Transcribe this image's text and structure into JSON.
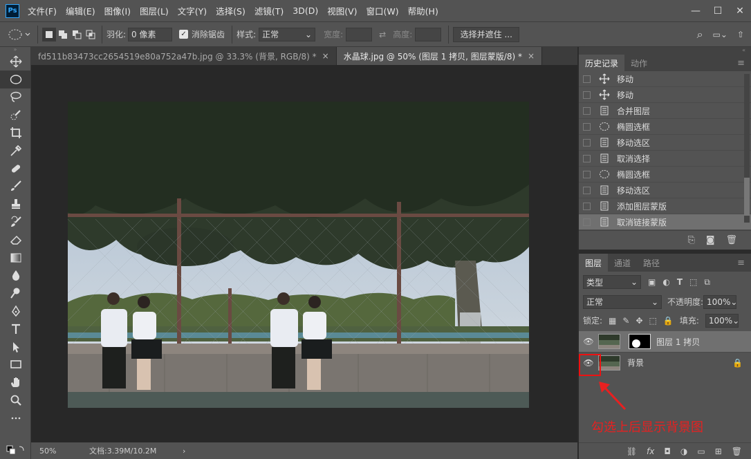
{
  "app": {
    "logo": "Ps"
  },
  "menu": [
    "文件(F)",
    "编辑(E)",
    "图像(I)",
    "图层(L)",
    "文字(Y)",
    "选择(S)",
    "滤镜(T)",
    "3D(D)",
    "视图(V)",
    "窗口(W)",
    "帮助(H)"
  ],
  "window_controls": {
    "minimize": "—",
    "maximize": "☐",
    "close": "✕"
  },
  "options": {
    "feather_label": "羽化:",
    "feather_value": "0 像素",
    "antialias_label": "消除锯齿",
    "antialias_checked": true,
    "style_label": "样式:",
    "style_value": "正常",
    "width_label": "宽度:",
    "height_label": "高度:",
    "select_mask_button": "选择并遮住 ..."
  },
  "tabs": [
    {
      "label": "fd511b83473cc2654519e80a752a47b.jpg @ 33.3% (背景, RGB/8) *",
      "close": "×"
    },
    {
      "label": "水晶球.jpg @ 50% (图层 1 拷贝, 图层蒙版/8) *",
      "close": "×"
    }
  ],
  "status": {
    "zoom": "50%",
    "doc": "文档:3.39M/10.2M",
    "arrow": "›"
  },
  "history_panel": {
    "tabs": [
      "历史记录",
      "动作"
    ],
    "items": [
      {
        "label": "移动",
        "icon": "move-icon"
      },
      {
        "label": "移动",
        "icon": "move-icon"
      },
      {
        "label": "合并图层",
        "icon": "doc-icon"
      },
      {
        "label": "椭圆选框",
        "icon": "ellipse-marquee-icon"
      },
      {
        "label": "移动选区",
        "icon": "doc-icon"
      },
      {
        "label": "取消选择",
        "icon": "doc-icon"
      },
      {
        "label": "椭圆选框",
        "icon": "ellipse-marquee-icon"
      },
      {
        "label": "移动选区",
        "icon": "doc-icon"
      },
      {
        "label": "添加图层蒙版",
        "icon": "doc-icon"
      },
      {
        "label": "取消链接蒙版",
        "icon": "doc-icon",
        "selected": true
      }
    ]
  },
  "layers_panel": {
    "tabs": [
      "图层",
      "通道",
      "路径"
    ],
    "filter_label": "类型",
    "blend_mode": "正常",
    "opacity_label": "不透明度:",
    "opacity_value": "100%",
    "lock_label": "锁定:",
    "fill_label": "填充:",
    "fill_value": "100%",
    "layers": [
      {
        "name": "图层 1 拷贝",
        "visible": true,
        "has_mask": true,
        "selected": true
      },
      {
        "name": "背景",
        "visible": true,
        "locked": true
      }
    ],
    "footer_fx": "fx"
  },
  "annotation": {
    "text": "勾选上后显示背景图",
    "color": "#e82020"
  },
  "colors": {
    "panel_bg": "#535353",
    "canvas_bg": "#282828",
    "selected_row": "#707070",
    "accent_blue": "#31a8ff"
  }
}
